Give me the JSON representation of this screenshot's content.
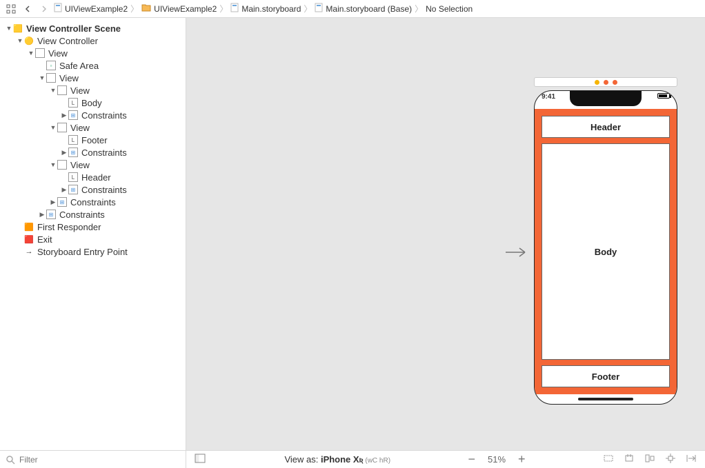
{
  "breadcrumbs": [
    {
      "label": "UIViewExample2",
      "icon": "project-icon"
    },
    {
      "label": "UIViewExample2",
      "icon": "folder-icon"
    },
    {
      "label": "Main.storyboard",
      "icon": "storyboard-icon"
    },
    {
      "label": "Main.storyboard (Base)",
      "icon": "storyboard-icon"
    },
    {
      "label": "No Selection",
      "icon": null
    }
  ],
  "tree": [
    {
      "indent": 0,
      "disclosure": "▼",
      "icon": "scene-icon",
      "iconEmoji": "🟨",
      "label": "View Controller Scene",
      "bold": true
    },
    {
      "indent": 1,
      "disclosure": "▼",
      "icon": "vc-icon",
      "iconEmoji": "🟡",
      "label": "View Controller"
    },
    {
      "indent": 2,
      "disclosure": "▼",
      "icon": "view-icon",
      "label": "View"
    },
    {
      "indent": 3,
      "disclosure": "",
      "icon": "safearea-icon",
      "label": "Safe Area"
    },
    {
      "indent": 3,
      "disclosure": "▼",
      "icon": "view-icon",
      "label": "View"
    },
    {
      "indent": 4,
      "disclosure": "▼",
      "icon": "view-icon",
      "label": "View"
    },
    {
      "indent": 5,
      "disclosure": "",
      "icon": "label-icon",
      "label": "Body"
    },
    {
      "indent": 5,
      "disclosure": "▶",
      "icon": "constraints-icon",
      "label": "Constraints"
    },
    {
      "indent": 4,
      "disclosure": "▼",
      "icon": "view-icon",
      "label": "View"
    },
    {
      "indent": 5,
      "disclosure": "",
      "icon": "label-icon",
      "label": "Footer"
    },
    {
      "indent": 5,
      "disclosure": "▶",
      "icon": "constraints-icon",
      "label": "Constraints"
    },
    {
      "indent": 4,
      "disclosure": "▼",
      "icon": "view-icon",
      "label": "View"
    },
    {
      "indent": 5,
      "disclosure": "",
      "icon": "label-icon",
      "label": "Header"
    },
    {
      "indent": 5,
      "disclosure": "▶",
      "icon": "constraints-icon",
      "label": "Constraints"
    },
    {
      "indent": 4,
      "disclosure": "▶",
      "icon": "constraints-icon",
      "label": "Constraints"
    },
    {
      "indent": 3,
      "disclosure": "▶",
      "icon": "constraints-icon",
      "label": "Constraints"
    },
    {
      "indent": 1,
      "disclosure": "",
      "icon": "firstresponder-icon",
      "iconEmoji": "🟧",
      "label": "First Responder"
    },
    {
      "indent": 1,
      "disclosure": "",
      "icon": "exit-icon",
      "iconEmoji": "🟥",
      "label": "Exit"
    },
    {
      "indent": 1,
      "disclosure": "",
      "icon": "entry-icon",
      "iconEmoji": "→",
      "label": "Storyboard Entry Point"
    }
  ],
  "filter": {
    "placeholder": "Filter"
  },
  "bottom": {
    "viewas_prefix": "View as: ",
    "viewas_device": "iPhone X",
    "viewas_suffix": "ʀ",
    "size_class": " (wC hR)",
    "zoom": "51%"
  },
  "device": {
    "time": "9:41",
    "header": "Header",
    "body": "Body",
    "footer": "Footer"
  },
  "resolve_dots": [
    "#f7b500",
    "#f36636",
    "#f36636"
  ]
}
